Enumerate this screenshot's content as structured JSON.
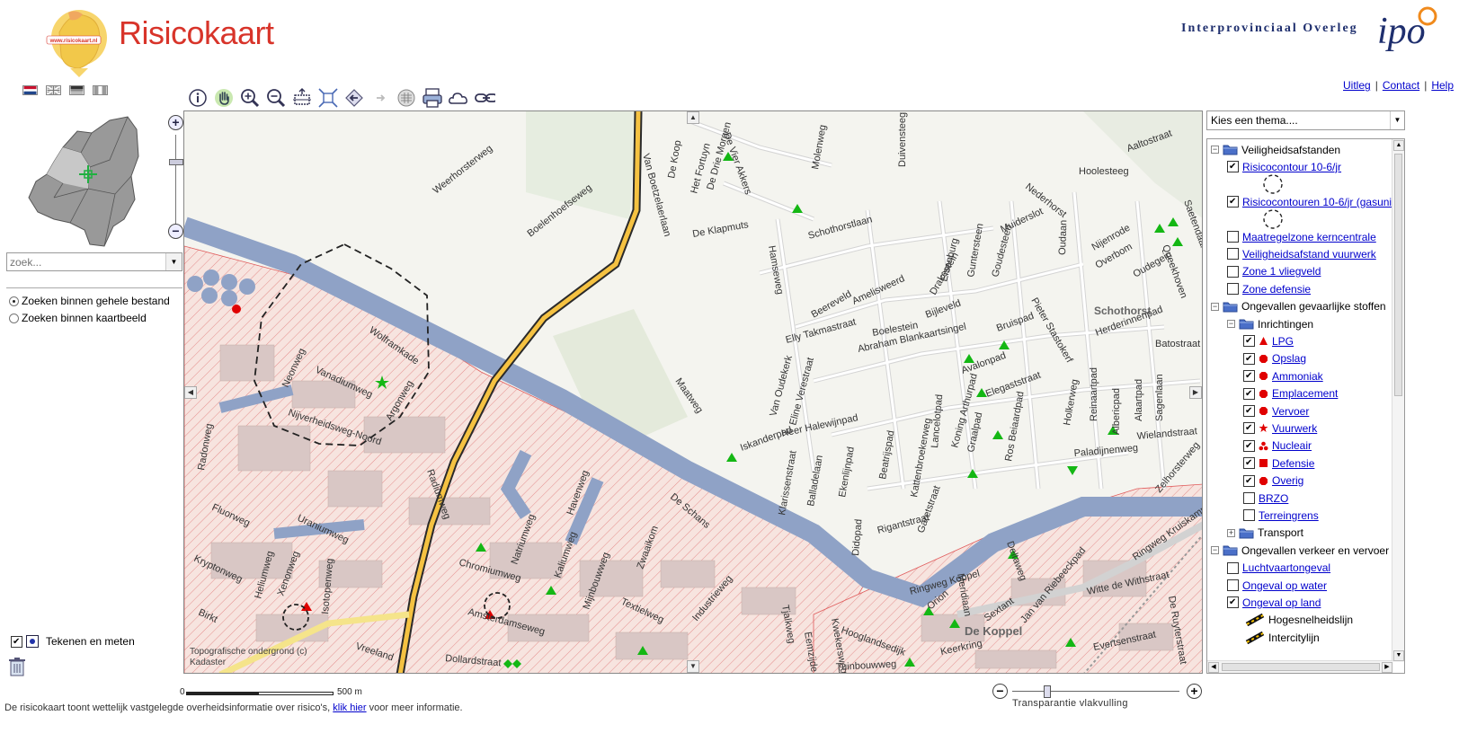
{
  "header": {
    "title": "Risicokaart",
    "logo_text": "www.risicokaart.nl",
    "partner_name": "Interprovinciaal Overleg",
    "partner_logo_text": "ipo"
  },
  "top_links": [
    {
      "label": "Uitleg"
    },
    {
      "label": "Contact"
    },
    {
      "label": "Help"
    }
  ],
  "languages": [
    {
      "icon": "flag-nl-icon"
    },
    {
      "icon": "flag-uk-icon"
    },
    {
      "icon": "flag-de-icon"
    },
    {
      "icon": "flag-fr-icon"
    }
  ],
  "overview_zoom": {
    "level": 0.28
  },
  "search": {
    "value": "",
    "placeholder": "zoek...",
    "options": [
      {
        "label": "Zoeken binnen gehele bestand",
        "selected": true
      },
      {
        "label": "Zoeken binnen kaartbeeld",
        "selected": false
      }
    ]
  },
  "tools_panel": {
    "draw_label": "Tekenen en meten",
    "draw_checked": true
  },
  "toolbar": [
    {
      "name": "info-icon"
    },
    {
      "name": "pan-hand-icon"
    },
    {
      "name": "zoom-in-icon"
    },
    {
      "name": "zoom-out-icon"
    },
    {
      "name": "zoom-box-icon"
    },
    {
      "name": "full-extent-icon"
    },
    {
      "name": "previous-extent-icon"
    },
    {
      "name": "next-extent-icon"
    },
    {
      "name": "table-icon"
    },
    {
      "name": "print-icon"
    },
    {
      "name": "cloud-icon"
    },
    {
      "name": "link-icon"
    }
  ],
  "map": {
    "attribution": "Topografische ondergrond (c) Kadaster",
    "labels": {
      "weerhorsterweg": "Weerhorsterweg",
      "boelenhoefseweg": "Boelenhoefseweg",
      "vanboetzelaerlaan": "Van Boetzelaerlaan",
      "dekoop": "De Koop",
      "hetfortuyn": "Het Fortuyn",
      "dedriemorgen": "De Drie Morgen",
      "devierakkers": "De Vier Akkers",
      "deklapmuts": "De Klapmuts",
      "molenweg": "Molenweg",
      "duivensteeg": "Duivensteeg",
      "aaltostraat": "Aaltostraat",
      "hoolesteeg": "Hoolesteeg",
      "nederhorst": "Nederhorst",
      "muiderslot": "Muiderslot",
      "schothorstlaan": "Schothorstlaan",
      "hamseweg": "Hamseweg",
      "eisenburg": "Eisenburg",
      "guntersteen": "Guntersteen",
      "goudesteen": "Goudesteen",
      "oudaan": "Oudaan",
      "nijenrode": "Nijenrode",
      "overbom": "Overbom",
      "oudegein": "Oudegein",
      "queekhoven": "Queekhoven",
      "saetendaal": "Saetendaal",
      "schothorst": "Schothorst",
      "amelisweerd": "Amelisweerd",
      "drakestein": "Drakestein",
      "bijleveld": "Bijleveld",
      "beereveld": "Beereveld",
      "boelestein": "Boelestein",
      "abraham": "Abraham Blankaartsingel",
      "bruispad": "Bruispad",
      "pieterstastokerf": "Pieter Stastokerf",
      "herderinnenpad": "Herderinnenpad",
      "batostraat": "Batostraat",
      "elly": "Elly Takmastraat",
      "vanoudekerk": "Van Oudekerk",
      "elineverestraat": "Eline Verestraat",
      "avalonpad": "Avalonpad",
      "elegaststraat": "Elegaststraat",
      "maatweg": "Maatweg",
      "iskanderpad": "Iskanderpad",
      "heerhalewijnpad": "Heer Halewijnpad",
      "lancelotpad": "Lancelotpad",
      "koningarthurpad": "Koning Arthurpad",
      "graalpad": "Graalpad",
      "rosbeiaardpad": "Ros Beiaardpad",
      "holkerweg": "Holkerweg",
      "reinaartpad": "Reinaartpad",
      "alaartpad": "Alaartpad",
      "sagenlaan": "Sagenlaan",
      "wielandstraat": "Wielandstraat",
      "paladijnenweg": "Paladijnenweg",
      "albericpad": "Albericpad",
      "zelhorsterweg": "Zelhorsterweg",
      "kattenbroekerweg": "Kattenbroekerweg",
      "klarissenstraat": "Klarissenstraat",
      "balladelaan": "Balladelaan",
      "ekenlijnpad": "Ekenlijnpad",
      "beatrijspad": "Beatrijspad",
      "didopad": "Didopad",
      "rigantstraat": "Rigantstraat",
      "garetstraat": "Garetstraat",
      "radonweg": "Radonweg",
      "neonweg": "Neonweg",
      "vanadiumweg": "Vanadiumweg",
      "wolframkade": "Wolframkade",
      "argonweg": "Argonweg",
      "nijverheidsweg": "Nijverheidsweg-Noord",
      "radiumweg": "Radiumweg",
      "fluorweg": "Fluorweg",
      "uraniumweg": "Uraniumweg",
      "kryptonweg": "Kryptonweg",
      "heliumweg": "Heliumweg",
      "xenonweg": "Xenonweg",
      "isotopenweg": "Isotopenweg",
      "birkt": "Birkt",
      "chromiumweg": "Chromiumweg",
      "natriumweg": "Natriumweg",
      "kaliumweg": "Kaliumweg",
      "havenweg": "Havenweg",
      "zwaaikom": "Zwaaikom",
      "mijnbouwweg": "Mijnbouwweg",
      "textielweg": "Textielweg",
      "industrieweg": "Industrieweg",
      "amsterdamseweg": "Amsterdamseweg",
      "vreeland": "Vreeland",
      "dollardstraat": "Dollardstraat",
      "deschans": "De Schans",
      "tjalkweg": "Tjalkweg",
      "eemzijde": "Eemzijde",
      "kwekersweg": "Kwekersweg",
      "hooglandsedijk": "Hooglandsedijk",
      "ringwegkoppel": "Ringweg Koppel",
      "dekoppel": "De Koppel",
      "orion": "Orion",
      "meridiaan": "Meridiaan",
      "sextant": "Sextant",
      "keerkring": "Keerkring",
      "deltaweg": "Deltaweg",
      "tuinbouwweg": "Tuinbouwweg",
      "janvanriebeeckpad": "Jan van Riebeeckpad",
      "wittedewithstraat": "Witte de Withstraat",
      "deruyterstraat": "De Ruyterstraat",
      "evertsenstraat": "Evertsenstraat",
      "ringwegkruiskamp": "Ringweg Kruiskamp"
    }
  },
  "scale": {
    "zero": "0",
    "distance": "500 m"
  },
  "transparency": {
    "label": "Transparantie vlakvulling",
    "value": 0.21
  },
  "footer": {
    "text": "De risicokaart toont wettelijk vastgelegde overheidsinformatie over risico's,",
    "link": "klik hier",
    "suffix": "voor meer informatie."
  },
  "theme": {
    "placeholder": "Kies een thema...."
  },
  "layers": [
    {
      "type": "folder",
      "label": "Veiligheidsafstanden",
      "level": 0,
      "expanded": true
    },
    {
      "type": "layer",
      "label": "Risicocontour 10-6/jr",
      "level": 1,
      "checked": true
    },
    {
      "type": "legend",
      "symbol": "dashed-circle-icon",
      "level": 1
    },
    {
      "type": "layer",
      "label": "Risicocontouren 10-6/jr (gasunie)",
      "level": 1,
      "checked": true
    },
    {
      "type": "legend",
      "symbol": "dashed-circle-icon",
      "level": 1
    },
    {
      "type": "layer",
      "label": "Maatregelzone kerncentrale",
      "level": 1,
      "checked": false
    },
    {
      "type": "layer",
      "label": "Veiligheidsafstand vuurwerk",
      "level": 1,
      "checked": false
    },
    {
      "type": "layer",
      "label": "Zone 1 vliegveld",
      "level": 1,
      "checked": false
    },
    {
      "type": "layer",
      "label": "Zone defensie",
      "level": 1,
      "checked": false
    },
    {
      "type": "folder",
      "label": "Ongevallen gevaarlijke stoffen",
      "level": 0,
      "expanded": true
    },
    {
      "type": "folder",
      "label": "Inrichtingen",
      "level": 1,
      "expanded": true
    },
    {
      "type": "layer",
      "label": "LPG",
      "level": 2,
      "checked": true,
      "symbol": "red-triangle-icon"
    },
    {
      "type": "layer",
      "label": "Opslag",
      "level": 2,
      "checked": true,
      "symbol": "red-octagon-icon"
    },
    {
      "type": "layer",
      "label": "Ammoniak",
      "level": 2,
      "checked": true,
      "symbol": "red-octagon-icon"
    },
    {
      "type": "layer",
      "label": "Emplacement",
      "level": 2,
      "checked": true,
      "symbol": "red-octagon-icon"
    },
    {
      "type": "layer",
      "label": "Vervoer",
      "level": 2,
      "checked": true,
      "symbol": "red-octagon-icon"
    },
    {
      "type": "layer",
      "label": "Vuurwerk",
      "level": 2,
      "checked": true,
      "symbol": "red-star-icon"
    },
    {
      "type": "layer",
      "label": "Nucleair",
      "level": 2,
      "checked": true,
      "symbol": "red-nuclear-icon"
    },
    {
      "type": "layer",
      "label": "Defensie",
      "level": 2,
      "checked": true,
      "symbol": "red-square-icon"
    },
    {
      "type": "layer",
      "label": "Overig",
      "level": 2,
      "checked": true,
      "symbol": "red-octagon-icon"
    },
    {
      "type": "layer",
      "label": "BRZO",
      "level": 2,
      "checked": false
    },
    {
      "type": "layer",
      "label": "Terreingrens",
      "level": 2,
      "checked": false
    },
    {
      "type": "folder",
      "label": "Transport",
      "level": 1,
      "expanded": false
    },
    {
      "type": "folder",
      "label": "Ongevallen verkeer en vervoer",
      "level": 0,
      "expanded": true
    },
    {
      "type": "layer",
      "label": "Luchtvaartongeval",
      "level": 1,
      "checked": false
    },
    {
      "type": "layer",
      "label": "Ongeval op water",
      "level": 1,
      "checked": false
    },
    {
      "type": "layer",
      "label": "Ongeval op land",
      "level": 1,
      "checked": true
    },
    {
      "type": "legend",
      "symbol": "rail-line-icon",
      "label": "Hogesnelheidslijn",
      "level": 1
    },
    {
      "type": "legend",
      "symbol": "rail-line-icon",
      "label": "Intercitylijn",
      "level": 1
    }
  ],
  "colors": {
    "title": "#d8342a",
    "link": "#0000cc",
    "partner": "#1f2f6e",
    "water": "#8fa2c6",
    "industry_hatch": "#e05a5a",
    "highway": "#f5c242",
    "marker_green": "#14b714",
    "marker_red": "#e00000"
  }
}
